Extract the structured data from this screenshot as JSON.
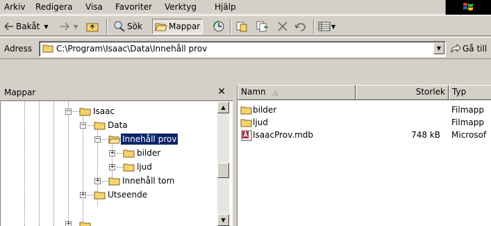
{
  "menu": {
    "items": [
      {
        "label": "Arkiv"
      },
      {
        "label": "Redigera"
      },
      {
        "label": "Visa"
      },
      {
        "label": "Favoriter"
      },
      {
        "label": "Verktyg"
      },
      {
        "label": "Hjälp"
      }
    ]
  },
  "toolbar": {
    "back_label": "Bakåt",
    "search_label": "Sök",
    "folders_label": "Mappar"
  },
  "address": {
    "label": "Adress",
    "value": "C:\\Program\\Isaac\\Data\\Innehåll prov",
    "go_label": "Gå till"
  },
  "folder_pane": {
    "title": "Mappar",
    "close_glyph": "✕",
    "tree": [
      {
        "label": "Isaac",
        "expanded": true
      },
      {
        "label": "Data",
        "expanded": true
      },
      {
        "label": "Innehåll prov",
        "expanded": true,
        "selected": true
      },
      {
        "label": "bilder",
        "expanded": false
      },
      {
        "label": "ljud",
        "expanded": false
      },
      {
        "label": "Innehåll tom",
        "expanded": false
      },
      {
        "label": "Utseende",
        "expanded": false
      }
    ]
  },
  "list": {
    "columns": [
      "Namn",
      "Storlek",
      "Typ"
    ],
    "rows": [
      {
        "name": "bilder",
        "size": "",
        "type": "Filmapp",
        "icon": "folder-icon"
      },
      {
        "name": "ljud",
        "size": "",
        "type": "Filmapp",
        "icon": "folder-icon"
      },
      {
        "name": "IsaacProv.mdb",
        "size": "748 kB",
        "type": "Microsof",
        "icon": "access-db-icon"
      }
    ]
  },
  "colors": {
    "chrome": "#d4d0c8",
    "selection": "#0a246a",
    "folder": "#f5d46c"
  }
}
